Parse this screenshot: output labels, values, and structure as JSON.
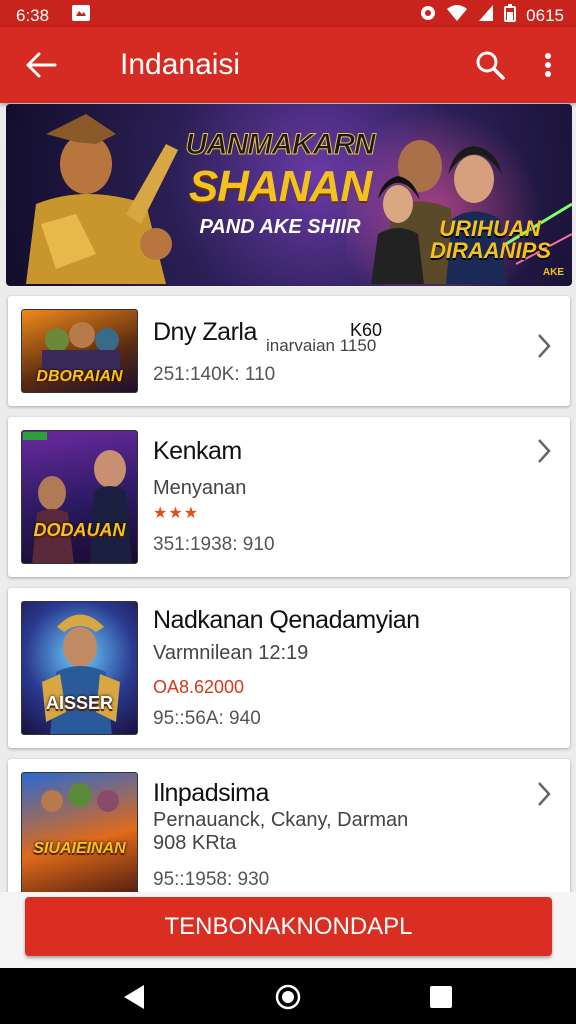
{
  "status_bar": {
    "time": "6:38",
    "right_time": "0615"
  },
  "app_bar": {
    "title": "Indanaisi"
  },
  "banner": {
    "line1": "UANMAKARN",
    "line2": "SHANAN",
    "line3": "PAND AKE SHIIR",
    "side_title": "URIHUAN DIRAANIPS",
    "badge": "AKE"
  },
  "items": [
    {
      "title": "Dny Zarla",
      "extra": "K60",
      "sub": "inarvaian 1150",
      "meta": "251:140K: 110",
      "thumb_label": "DBORAIAN"
    },
    {
      "title": "Kenkam",
      "sub": "Menyanan",
      "stars": "★★★",
      "meta": "351:1938: 910",
      "thumb_label": "DODAUAN"
    },
    {
      "title": "Nadkanan Qenadamyian",
      "sub": "Varmnilean 12:19",
      "price": "OA8.62000",
      "meta": "95::56A: 940",
      "thumb_label": "AISSER"
    },
    {
      "title": "Ilnpadsima",
      "sub": "Pernauanck, Ckany, Darman",
      "sub2": "908 KRta",
      "meta": "95::1958: 930",
      "thumb_label": "SIUAIEINAN"
    }
  ],
  "cta": {
    "label": "TENBONAKNONDAPL"
  }
}
